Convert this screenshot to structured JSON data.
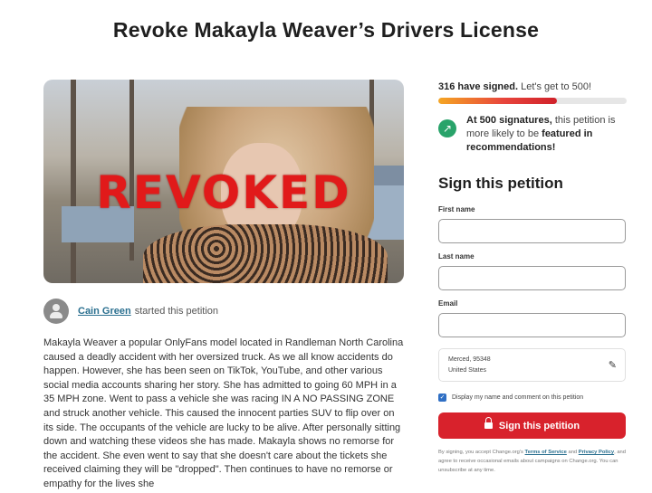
{
  "petition": {
    "title": "Revoke Makayla Weaver’s Drivers License",
    "image_stamp": "REVOKED",
    "starter_name": "Cain Green",
    "starter_suffix": "started this petition",
    "body": "Makayla Weaver a popular OnlyFans model located in Randleman North Carolina caused a deadly accident with her oversized truck. As we all know accidents do happen. However, she has been seen on TikTok, YouTube, and other various social media accounts sharing her story. She has admitted to going 60 MPH in a 35 MPH zone. Went to pass a vehicle she was racing IN A NO PASSING ZONE and struck another vehicle. This caused the innocent parties SUV to flip over on its side. The occupants of the vehicle are lucky to be alive. After personally sitting down and watching these videos she has made. Makayla shows no remorse for the accident. She even went to say that she doesn't care about the tickets she received claiming they will be \"dropped\". Then continues to have no remorse or empathy for the lives she"
  },
  "signatures": {
    "count_label": "316 have signed.",
    "goal_label": "Let's get to 500!",
    "progress": 0.632,
    "milestone_prefix": "At 500 signatures,",
    "milestone_middle": "this petition is more likely to be",
    "milestone_bold": "featured in recommendations!"
  },
  "form": {
    "heading": "Sign this petition",
    "first_name_label": "First name",
    "last_name_label": "Last name",
    "email_label": "Email",
    "location_line1": "Merced, 95348",
    "location_line2": "United States",
    "display_checkbox_label": "Display my name and comment on this petition",
    "submit_label": "Sign this petition",
    "disclaimer_start": "By signing, you accept Change.org's",
    "terms_link": "Terms of Service",
    "disclaimer_and": "and",
    "privacy_link": "Privacy Policy",
    "disclaimer_end": ", and agree to receive occasional emails about campaigns on Change.org. You can unsubscribe at any time."
  },
  "icons": {
    "trend": "trend-up-icon",
    "pencil": "pencil-icon",
    "lock": "lock-icon",
    "avatar": "user-avatar-icon"
  },
  "colors": {
    "primary_red": "#d8222c",
    "milestone_green": "#29a36a",
    "link": "#2a6f8f",
    "checkbox": "#2f6fc4"
  }
}
